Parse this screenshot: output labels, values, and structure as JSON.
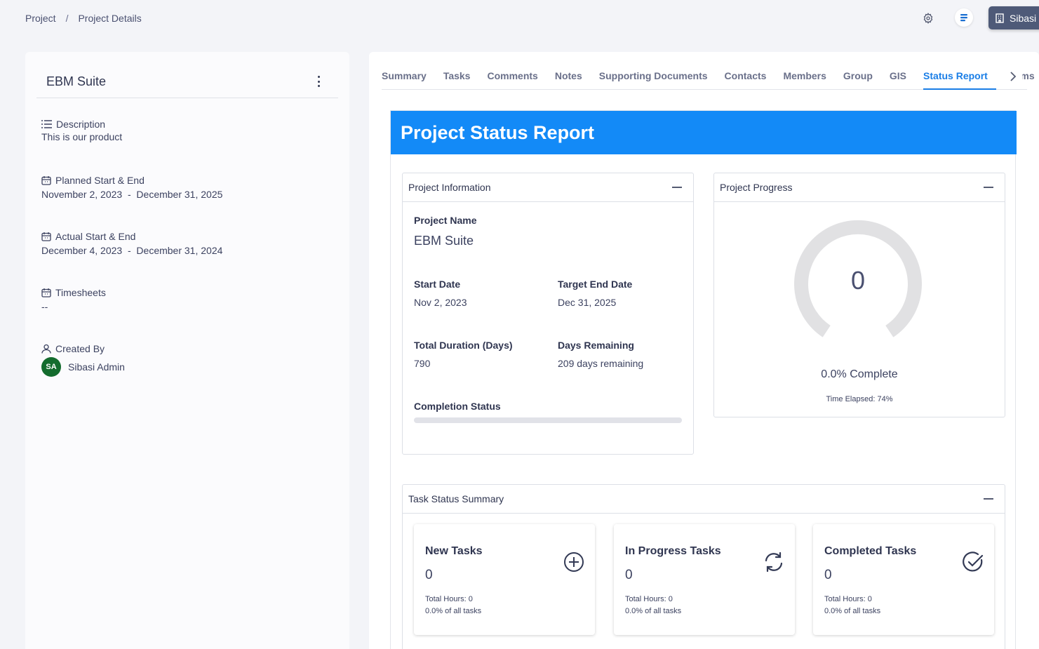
{
  "breadcrumb": {
    "root": "Project",
    "separator": "/",
    "current": "Project Details"
  },
  "header": {
    "org_label": "Sibasi L"
  },
  "project_card": {
    "title": "EBM Suite",
    "description_label": "Description",
    "description_value": "This is our product",
    "planned_label": "Planned Start & End",
    "planned_start": "November 2, 2023",
    "planned_sep": "-",
    "planned_end": "December 31, 2025",
    "actual_label": "Actual Start & End",
    "actual_start": "December 4, 2023",
    "actual_sep": "-",
    "actual_end": "December 31, 2024",
    "timesheets_label": "Timesheets",
    "timesheets_value": "--",
    "created_by_label": "Created By",
    "creator_initials": "SA",
    "creator_name": "Sibasi Admin"
  },
  "tabs": [
    "Summary",
    "Tasks",
    "Comments",
    "Notes",
    "Supporting Documents",
    "Contacts",
    "Members",
    "Group",
    "GIS",
    "Status Report",
    "Forms"
  ],
  "active_tab": "Status Report",
  "report": {
    "title": "Project Status Report",
    "info": {
      "header": "Project Information",
      "name_label": "Project Name",
      "name_value": "EBM Suite",
      "start_label": "Start Date",
      "start_value": "Nov 2, 2023",
      "target_label": "Target End Date",
      "target_value": "Dec 31, 2025",
      "duration_label": "Total Duration (Days)",
      "duration_value": "790",
      "remaining_label": "Days Remaining",
      "remaining_value": "209 days remaining",
      "completion_label": "Completion Status",
      "completion_fraction": 0
    },
    "progress": {
      "header": "Project Progress",
      "gauge_value": "0",
      "complete_text": "0.0% Complete",
      "elapsed_text": "Time Elapsed: 74%"
    },
    "task_summary": {
      "header": "Task Status Summary",
      "cards": [
        {
          "title": "New Tasks",
          "count": "0",
          "hours": "Total Hours: 0",
          "pct": "0.0% of all tasks",
          "icon": "plus-circle-icon"
        },
        {
          "title": "In Progress Tasks",
          "count": "0",
          "hours": "Total Hours: 0",
          "pct": "0.0% of all tasks",
          "icon": "refresh-icon"
        },
        {
          "title": "Completed Tasks",
          "count": "0",
          "hours": "Total Hours: 0",
          "pct": "0.0% of all tasks",
          "icon": "check-circle-icon"
        }
      ]
    }
  },
  "colors": {
    "accent": "#138af7",
    "avatar": "#146c2e",
    "chip": "#4e5a78"
  }
}
